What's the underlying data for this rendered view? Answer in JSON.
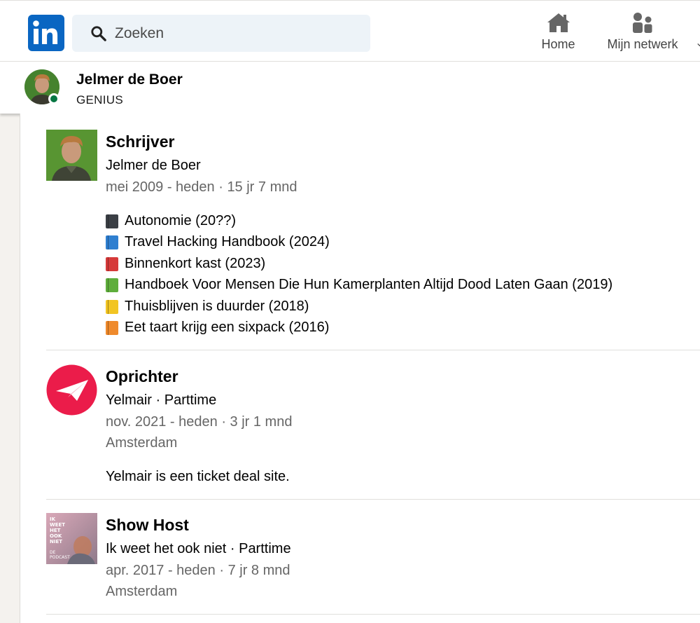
{
  "header": {
    "search_placeholder": "Zoeken",
    "nav": [
      {
        "label": "Home"
      },
      {
        "label": "Mijn netwerk"
      }
    ]
  },
  "profile": {
    "name": "Jelmer de Boer",
    "headline": "GENIUS"
  },
  "experience": [
    {
      "title": "Schrijver",
      "company": "Jelmer de Boer",
      "period": "mei 2009 - heden · 15 jr 7 mnd",
      "books": [
        {
          "text": "Autonomie (20??)",
          "color": "#3b3f45"
        },
        {
          "text": "Travel Hacking Handbook (2024)",
          "color": "#2f7fd0"
        },
        {
          "text": "Binnenkort kast (2023)",
          "color": "#d63a3a"
        },
        {
          "text": "Handboek Voor Mensen Die Hun Kamerplanten Altijd Dood Laten Gaan (2019)",
          "color": "#5fae3c"
        },
        {
          "text": "Thuisblijven is duurder (2018)",
          "color": "#f2c523"
        },
        {
          "text": "Eet taart krijg een sixpack (2016)",
          "color": "#ef8a2c"
        }
      ]
    },
    {
      "title": "Oprichter",
      "company": "Yelmair · Parttime",
      "period": "nov. 2021 - heden · 3 jr 1 mnd",
      "location": "Amsterdam",
      "description": "Yelmair is een ticket deal site."
    },
    {
      "title": "Show Host",
      "company": "Ik weet het ook niet · Parttime",
      "period": "apr. 2017 - heden · 7 jr 8 mnd",
      "location": "Amsterdam",
      "logo_text": [
        "IK",
        "WEET",
        "HET",
        "OOK",
        "NIET",
        "DE",
        "PODCAST"
      ]
    }
  ],
  "colors": {
    "linkedin_blue": "#0a66c2",
    "yelmair_red": "#eb1c4a",
    "online_green": "#057642"
  }
}
